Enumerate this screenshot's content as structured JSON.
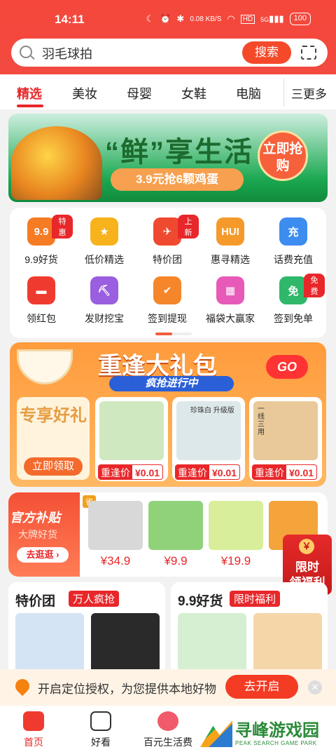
{
  "status": {
    "time": "14:11",
    "net": "0.08 KB/S",
    "hd": "HD",
    "net_gen": "5G",
    "battery": "100"
  },
  "search": {
    "placeholder": "羽毛球拍",
    "button": "搜索"
  },
  "tabs": [
    "精选",
    "美妆",
    "母婴",
    "女鞋",
    "电脑"
  ],
  "tabs_more": "三更多",
  "banner": {
    "title": "“鲜”享生活",
    "subtitle": "3.9元抢6颗鸡蛋",
    "button": "立即抢购"
  },
  "icons": [
    {
      "label": "9.9好货",
      "badge": "特惠",
      "glyph": "9.9",
      "color": "#f57b24"
    },
    {
      "label": "低价精选",
      "badge": "",
      "glyph": "★",
      "color": "#f7b21c"
    },
    {
      "label": "特价团",
      "badge": "上新",
      "glyph": "✈",
      "color": "#ef4a2f"
    },
    {
      "label": "惠寻精选",
      "badge": "",
      "glyph": "HUI",
      "color": "#f59a2a"
    },
    {
      "label": "话费充值",
      "badge": "",
      "glyph": "充",
      "color": "#3d8cf0"
    },
    {
      "label": "领红包",
      "badge": "",
      "glyph": "▬",
      "color": "#ef3b2f"
    },
    {
      "label": "发财挖宝",
      "badge": "",
      "glyph": "⛏",
      "color": "#9a5ee0"
    },
    {
      "label": "签到提现",
      "badge": "",
      "glyph": "✔",
      "color": "#f5862a"
    },
    {
      "label": "福袋大赢家",
      "badge": "",
      "glyph": "▦",
      "color": "#e75ab8"
    },
    {
      "label": "签到免单",
      "badge": "免费",
      "glyph": "免",
      "color": "#2fb86a"
    }
  ],
  "gift": {
    "title": "重逢大礼包",
    "subtitle": "疯抢进行中",
    "go": "GO",
    "promo_title": "专享好礼",
    "promo_button": "立即领取",
    "products": [
      {
        "tag": "重逢价",
        "price": "¥0.01",
        "color": "#cfe8c0"
      },
      {
        "tag": "重逢价",
        "price": "¥0.01",
        "color": "#dde8ea",
        "caption": "珍珠白 升级版"
      },
      {
        "tag": "重逢价",
        "price": "¥0.01",
        "color": "#e9c99a",
        "caption": "一线三用"
      }
    ]
  },
  "guanfang": {
    "title": "官方补贴",
    "subtitle": "大牌好货",
    "button": "去逛逛 ›",
    "tag": "省",
    "items": [
      {
        "price": "¥34.9",
        "color": "#d8d8d8"
      },
      {
        "price": "¥9.9",
        "color": "#8fd27a"
      },
      {
        "price": "¥19.9",
        "color": "#d9ee9a"
      },
      {
        "price": "",
        "color": "#f4a43a"
      }
    ]
  },
  "limit": {
    "text1": "限时",
    "text2": "领福利"
  },
  "cards": [
    {
      "title": "特价团",
      "tag": "万人疯抢",
      "pics": [
        "#d4e4f4",
        "#2a2a2a"
      ]
    },
    {
      "title": "9.9好货",
      "tag": "限时福利",
      "pics": [
        "#d6efd2",
        "#f5d6a8"
      ]
    }
  ],
  "location": {
    "text": "开启定位授权，为您提供本地好物",
    "button": "去开启",
    "close": "✕"
  },
  "nav": [
    "首页",
    "好看",
    "百元生活费"
  ],
  "watermark": {
    "title": "寻峰游戏园",
    "sub": "PEAK SEARCH GAME PARK"
  }
}
